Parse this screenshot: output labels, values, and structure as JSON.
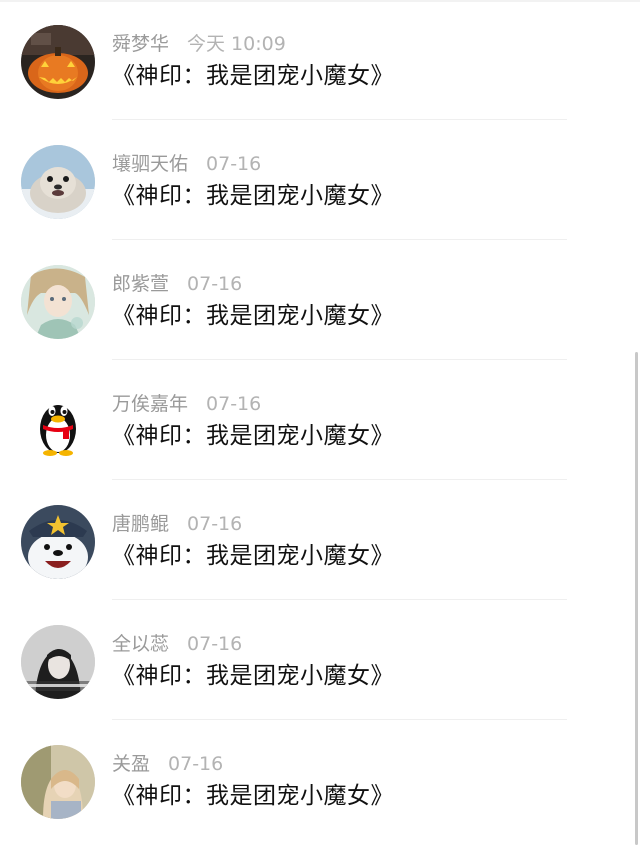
{
  "comments": [
    {
      "name": "舜梦华",
      "time": "今天 10:09",
      "message": "《神印：我是团宠小魔女》",
      "avatar_icon": "pumpkin-avatar-icon"
    },
    {
      "name": "壤驷天佑",
      "time": "07-16",
      "message": "《神印：我是团宠小魔女》",
      "avatar_icon": "seal-avatar-icon"
    },
    {
      "name": "郎紫萱",
      "time": "07-16",
      "message": "《神印：我是团宠小魔女》",
      "avatar_icon": "anime-girl-avatar-icon"
    },
    {
      "name": "万俟嘉年",
      "time": "07-16",
      "message": "《神印：我是团宠小魔女》",
      "avatar_icon": "qq-penguin-avatar-icon"
    },
    {
      "name": "唐鹏鲲",
      "time": "07-16",
      "message": "《神印：我是团宠小魔女》",
      "avatar_icon": "polar-bear-avatar-icon"
    },
    {
      "name": "全以蕊",
      "time": "07-16",
      "message": "《神印：我是团宠小魔女》",
      "avatar_icon": "girl-photo-avatar-icon"
    },
    {
      "name": "关盈",
      "time": "07-16",
      "message": "《神印：我是团宠小魔女》",
      "avatar_icon": "child-photo-avatar-icon"
    }
  ],
  "colors": {
    "name_text": "#9a9a9a",
    "time_text": "#b3b3b3",
    "message_text": "#111111",
    "divider": "#efefef"
  }
}
